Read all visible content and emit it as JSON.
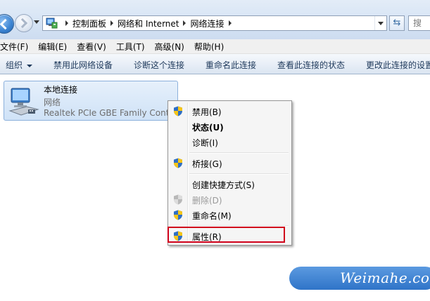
{
  "address_bar": {
    "breadcrumbs": [
      "控制面板",
      "网络和 Internet",
      "网络连接"
    ],
    "search_placeholder": "搜"
  },
  "menu_bar": {
    "items": [
      "文件(F)",
      "编辑(E)",
      "查看(V)",
      "工具(T)",
      "高级(N)",
      "帮助(H)"
    ]
  },
  "command_bar": {
    "organize": "组织",
    "items": [
      "禁用此网络设备",
      "诊断这个连接",
      "重命名此连接",
      "查看此连接的状态",
      "更改此连接的设置"
    ]
  },
  "connection": {
    "name": "本地连接",
    "network": "网络",
    "device": "Realtek PCIe GBE Family Controller"
  },
  "context_menu": {
    "items": [
      {
        "label": "禁用(B)",
        "icon": "shield-icon"
      },
      {
        "label": "状态(U)",
        "bold": true
      },
      {
        "label": "诊断(I)"
      },
      {
        "label": "桥接(G)",
        "icon": "shield-icon"
      },
      {
        "label": "创建快捷方式(S)"
      },
      {
        "label": "删除(D)",
        "icon": "shield-icon",
        "disabled": true
      },
      {
        "label": "重命名(M)",
        "icon": "shield-icon"
      },
      {
        "label": "属性(R)",
        "icon": "shield-icon",
        "highlighted": true
      }
    ],
    "highlight_color": "#d0021b"
  },
  "watermark": {
    "text": "Weimahe.com"
  }
}
